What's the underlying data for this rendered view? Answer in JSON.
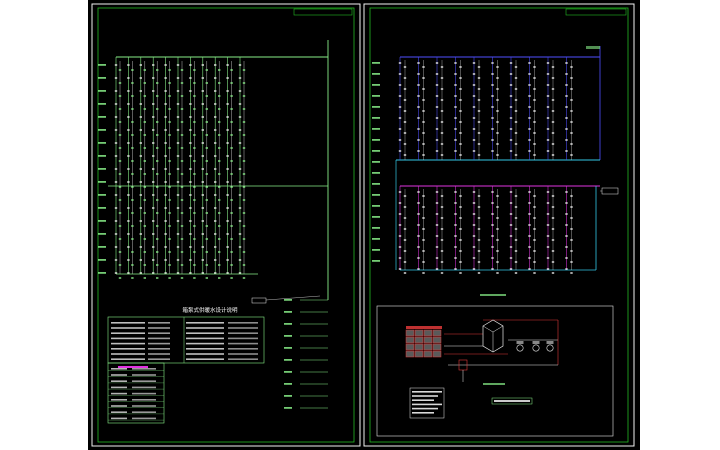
{
  "colors": {
    "background": "#000000",
    "page": "#ffffff",
    "frame": "#f2f2f2",
    "border_inner": "#22bb22",
    "pipe_green": "#88ee88",
    "pipe_white": "#e8e8e8",
    "pipe_blue": "#4f4fff",
    "pipe_cyan": "#33c7e6",
    "pipe_magenta": "#e033e0",
    "pipe_red": "#e03a3a",
    "annotation_white": "#ffffff"
  },
  "icons": [
    "tank-icon",
    "pump-icon",
    "valve-icon",
    "manifold-icon"
  ],
  "left_sheet": {
    "spec_title": "箱泵式供暖水设计说明"
  },
  "right_sheet": {
    "panels": [
      "riser-diagram-upper",
      "riser-diagram-lower",
      "equipment-room-schematic"
    ]
  }
}
